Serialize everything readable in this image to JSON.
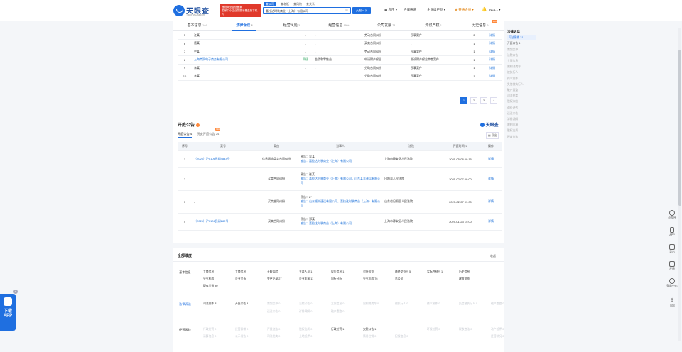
{
  "header": {
    "logo_name": "天眼查",
    "logo_domain": "TianYanCha.com",
    "banner_line1": "国家中小企业发展子基金旗下机构",
    "banner_line2": "首批商业征信备案",
    "search_tabs": [
      "查公司",
      "查老板",
      "查风险",
      "查关系"
    ],
    "search_value": "喜拉达时装商业（上海）有限公司",
    "search_button": "天眼一下",
    "nav": [
      "应用",
      "合作通道",
      "企业级产品",
      "开通会员",
      "tyc4..."
    ]
  },
  "tabs": [
    {
      "label": "基本信息",
      "count": "144"
    },
    {
      "label": "法律诉讼",
      "count": "6"
    },
    {
      "label": "经营风险",
      "count": "3"
    },
    {
      "label": "经营信息",
      "count": "999+"
    },
    {
      "label": "公司发展",
      "count": "73"
    },
    {
      "label": "知识产权",
      "count": "1"
    },
    {
      "label": "历史信息",
      "count": "64",
      "badge": "Hot"
    }
  ],
  "lawsuit_rows": [
    {
      "no": "5",
      "party": "江某",
      "c1": "-",
      "c2": "-",
      "cause": "劳动合同纠纷",
      "type": "民事案件",
      "n": "2",
      "act": "详情"
    },
    {
      "no": "6",
      "party": "唐某",
      "c1": "-",
      "c2": "-",
      "cause": "买卖合同纠纷",
      "type": "-",
      "n": "1",
      "act": "详情"
    },
    {
      "no": "7",
      "party": "史某",
      "c1": "-",
      "c2": "-",
      "cause": "劳动合同纠纷",
      "type": "民事案件",
      "n": "1",
      "act": "详情"
    },
    {
      "no": "8",
      "party": "上海商贸电子商务有限公司",
      "c1": "甲级",
      "c2": "金货和零售业",
      "cause": "申请财产保全",
      "type": "非诉财产保全审查案件",
      "n": "1",
      "act": "详情"
    },
    {
      "no": "9",
      "party": "朱某",
      "c1": "-",
      "c2": "-",
      "cause": "劳动合同纠纷",
      "type": "民事案件",
      "n": "1",
      "act": "详情"
    },
    {
      "no": "10",
      "party": "李某",
      "c1": "-",
      "c2": "-",
      "cause": "劳动合同纠纷",
      "type": "民事案件",
      "n": "1",
      "act": "详情"
    }
  ],
  "pager": [
    "1",
    "2",
    "3",
    ">"
  ],
  "court": {
    "title": "开庭公告",
    "brand": "天眼查",
    "tab1": "开庭公告 4",
    "tab2": "历史开庭公告 34",
    "export": "导出",
    "headers": [
      "序号",
      "案号",
      "案由",
      "当事人",
      "法院",
      "开庭时间",
      "操作"
    ],
    "rows": [
      {
        "no": "1",
        "case": "（2025）沪0106民初4844号",
        "cause": "信息网络买卖合同纠纷",
        "p1": "原告：吴某",
        "p2": "被告：喜拉达时装商业（上海）有限公司",
        "court": "上海市静安区人民法院",
        "time": "2025-05-08 09:15",
        "act": "详情"
      },
      {
        "no": "2",
        "case": "-",
        "cause": "买卖合同纠纷",
        "p1": "原告：张某",
        "p2": "被告：喜拉达时装商业（上海）有限公司，山东某丰速运有限公司",
        "court": "日照县人民法院",
        "time": "2025-02-07 09:00",
        "act": "详情"
      },
      {
        "no": "3",
        "case": "-",
        "cause": "买卖合同纠纷",
        "p1": "原告：Z*",
        "p2": "被告：山东顺丰速运有限公司，喜拉达时装商业（上海）有限公司",
        "court": "山东省日照县人民法院",
        "time": "2025-02-07 09:00",
        "act": "详情"
      },
      {
        "no": "4",
        "case": "（2025）沪0106民初282号",
        "cause": "买卖合同纠纷",
        "p1": "原告：郑某",
        "p2": "被告：喜拉达时装商业（上海）有限公司",
        "court": "上海市静安区人民法院",
        "time": "2025-01-23 14:00",
        "act": "详情"
      }
    ]
  },
  "dims": {
    "title": "全部维度",
    "collapse": "收起",
    "basic_label": "基本信息",
    "basic": [
      [
        "工商信息",
        "工商信息",
        "天眼风险",
        "主要人员 1",
        "股东信息 1",
        "对外投资",
        "最终受益人 5",
        "实际控制人 1",
        "历史信息"
      ],
      [
        "分支机构",
        "企业关系",
        "变更记录 27",
        "企业年报 11",
        "同行分析",
        "分支机构 76",
        "总公司",
        "",
        "建筑资质"
      ],
      [
        "疑似关系 30"
      ]
    ],
    "law_label": "法律诉讼",
    "law": [
      "司法案件 31",
      "开庭公告 4",
      "裁判文书 0",
      "法院公告 0",
      "立案信息 0",
      "限制消费令 0",
      "被执行人 0",
      "终本案件 0",
      "失信被执行人 0",
      "破产重整 0"
    ],
    "law2": [
      "",
      "",
      "送达公告 0",
      "诉前调解 0",
      "破产重整 0"
    ],
    "biz_label": "经营风险",
    "biz": [
      "行政处罚 0",
      "经营异常 0",
      "严重违法 0",
      "股权出质 0",
      "行政处罚 1",
      "欠税公告 1",
      "",
      "环保处罚 0",
      "税收违法 0",
      "动产抵押 0"
    ],
    "biz2": [
      "清算信息 0",
      "公示催告 0",
      "司法拍卖 0",
      "土地抵押 0",
      "",
      "简易注销 0",
      "担保信息 0",
      "",
      "",
      "经营状况 0"
    ]
  },
  "rightnav": {
    "head": "法律诉讼",
    "items": [
      "司法案件 31",
      "开庭公告 4",
      "裁判文书",
      "法院公告",
      "立案信息",
      "限制消费令",
      "被执行人",
      "终本案件",
      "失信被执行人",
      "破产重整",
      "司法拍卖",
      "股权冻结",
      "询价评估",
      "送达公告",
      "诉前调解",
      "限制出境",
      "股权出质",
      "税收违法"
    ]
  },
  "float": [
    "小程序",
    "APP",
    "导出",
    "反馈",
    "帮助中心",
    "顶部"
  ],
  "download": {
    "line1": "下载",
    "line2": "APP"
  }
}
